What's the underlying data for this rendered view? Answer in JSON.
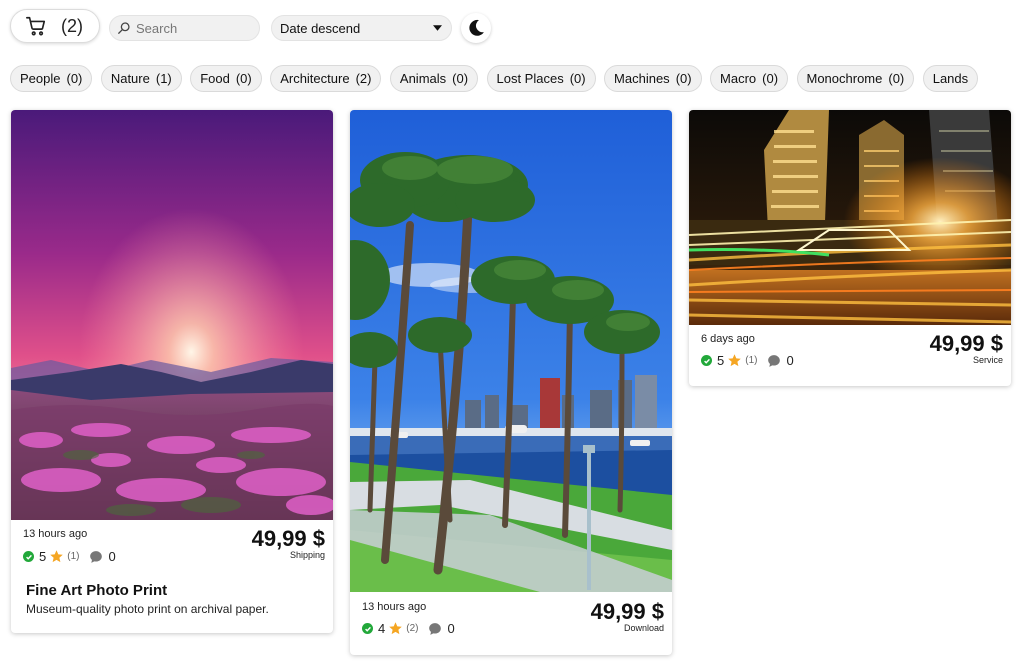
{
  "header": {
    "cart_count": "(2)",
    "search_placeholder": "Search",
    "sort_label": "Date descend"
  },
  "categories": [
    {
      "name": "People",
      "count": "(0)"
    },
    {
      "name": "Nature",
      "count": "(1)"
    },
    {
      "name": "Food",
      "count": "(0)"
    },
    {
      "name": "Architecture",
      "count": "(2)"
    },
    {
      "name": "Animals",
      "count": "(0)"
    },
    {
      "name": "Lost Places",
      "count": "(0)"
    },
    {
      "name": "Machines",
      "count": "(0)"
    },
    {
      "name": "Macro",
      "count": "(0)"
    },
    {
      "name": "Monochrome",
      "count": "(0)"
    },
    {
      "name": "Lands",
      "count": ""
    }
  ],
  "cards": [
    {
      "image": "sunset-flowers-mountains",
      "time": "13 hours ago",
      "price": "49,99 $",
      "type": "Shipping",
      "rating": "5",
      "rating_count": "(1)",
      "comments": "0",
      "title": "Fine Art Photo Print",
      "description": "Museum-quality photo print on archival paper."
    },
    {
      "image": "palm-trees-marina-city",
      "time": "13 hours ago",
      "price": "49,99 $",
      "type": "Download",
      "rating": "4",
      "rating_count": "(2)",
      "comments": "0"
    },
    {
      "image": "city-night-light-trails",
      "time": "6 days ago",
      "price": "49,99 $",
      "type": "Service",
      "rating": "5",
      "rating_count": "(1)",
      "comments": "0"
    }
  ],
  "colors": {
    "verified": "#22a83a",
    "star": "#f5a623",
    "comment_icon": "#777777"
  }
}
